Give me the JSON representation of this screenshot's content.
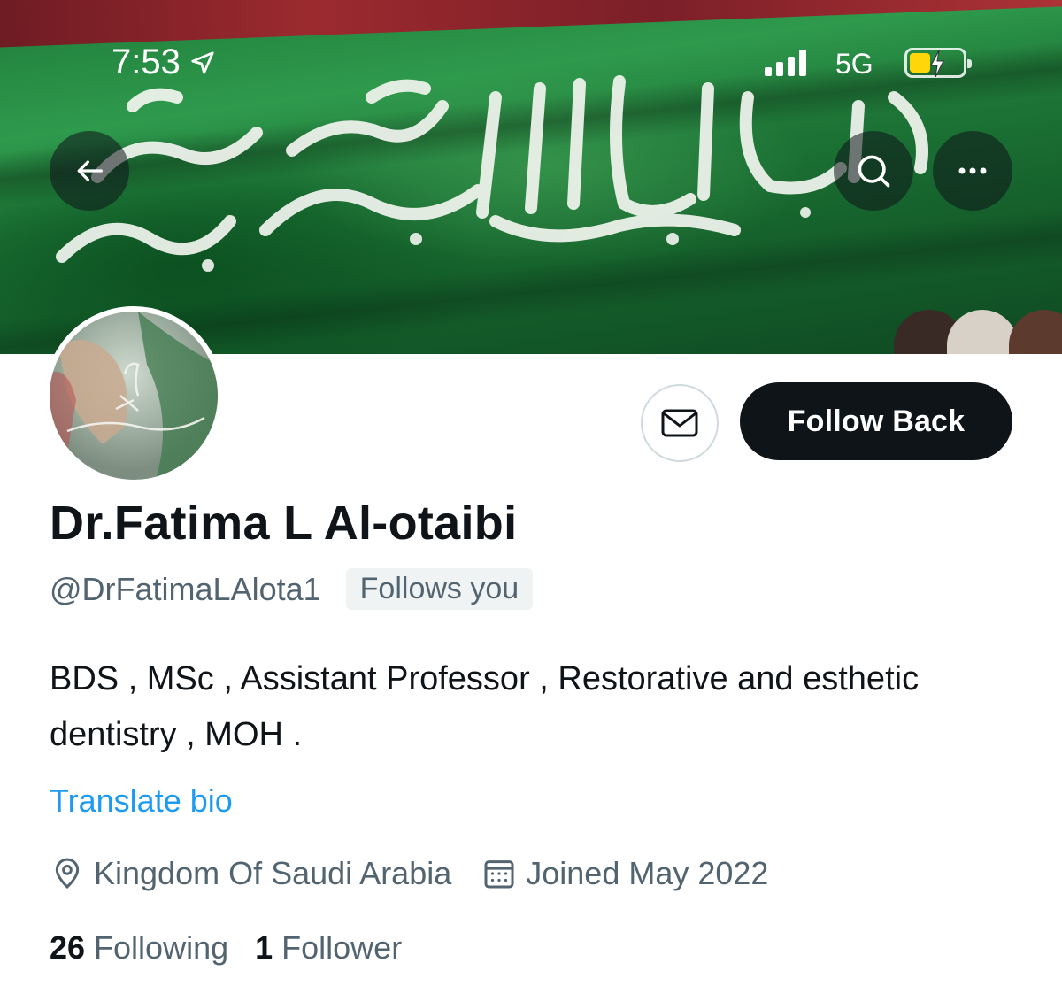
{
  "status_bar": {
    "time": "7:53",
    "network": "5G",
    "signal_bars": 4,
    "battery_level": 0.4,
    "location_icon": "location-arrow-icon",
    "battery_color": "#ffd60a"
  },
  "nav": {
    "back_icon": "arrow-left-icon",
    "search_icon": "search-icon",
    "more_icon": "more-horizontal-icon"
  },
  "banner": {
    "description_colors": {
      "flag_green": "#1f7a3a",
      "red_strip": "#9b2a2f"
    }
  },
  "profile": {
    "display_name": "Dr.Fatima L Al-otaibi",
    "handle": "@DrFatimaLAlota1",
    "follows_you": "Follows you",
    "bio": "BDS , MSc , Assistant Professor , Restorative and esthetic dentistry , MOH .",
    "translate_bio": "Translate bio",
    "location": "Kingdom Of Saudi Arabia",
    "joined": "Joined May 2022",
    "following_count": "26",
    "following_label": "Following",
    "followers_count": "1",
    "followers_label": "Follower"
  },
  "actions": {
    "message_icon": "envelope-icon",
    "follow_back_label": "Follow Back"
  },
  "colors": {
    "primary_text": "#0f1419",
    "secondary_text": "#536471",
    "link": "#1d9bf0",
    "button_dark": "#0f1419"
  }
}
